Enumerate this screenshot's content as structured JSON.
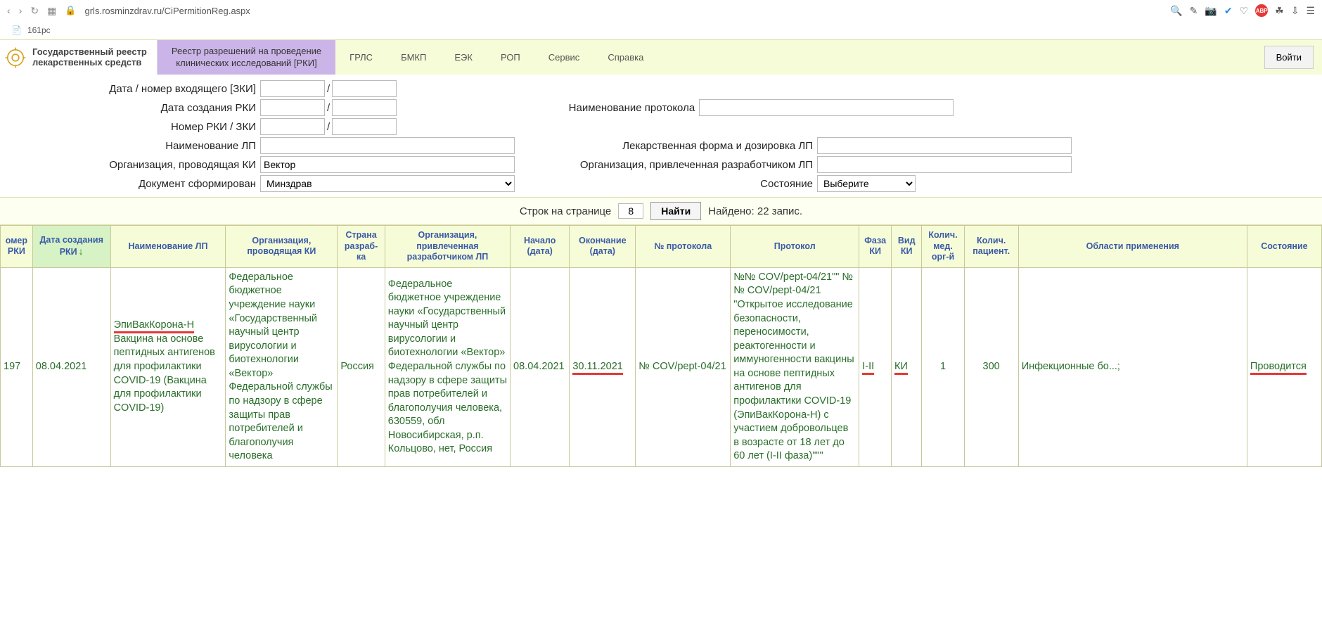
{
  "browser": {
    "url": "grls.rosminzdrav.ru/CiPermitionReg.aspx",
    "tab_title": "161pc"
  },
  "header": {
    "logo_line1": "Государственный реестр",
    "logo_line2": "лекарственных средств",
    "tabs": {
      "active_line1": "Реестр разрешений на проведение",
      "active_line2": "клинических исследований [РКИ]",
      "grls": "ГРЛС",
      "bmkp": "БМКП",
      "eek": "ЕЭК",
      "rop": "РОП",
      "service": "Сервис",
      "help": "Справка"
    },
    "login": "Войти"
  },
  "filters": {
    "l_date_incoming": "Дата / номер входящего [ЗКИ]",
    "l_date_created": "Дата создания РКИ",
    "l_number": "Номер РКИ / ЗКИ",
    "l_lp_name": "Наименование ЛП",
    "l_org_conducting": "Организация, проводящая КИ",
    "l_doc_formed": "Документ сформирован",
    "l_protocol_name": "Наименование протокола",
    "l_dosage_form": "Лекарственная форма и дозировка ЛП",
    "l_org_dev": "Организация, привлеченная разработчиком ЛП",
    "l_state": "Состояние",
    "v_org_conducting": "Вектор",
    "v_doc_formed": "Минздрав",
    "v_state": "Выберите"
  },
  "pager": {
    "rows_label": "Строк на странице",
    "rows_value": "8",
    "find": "Найти",
    "found": "Найдено: 22 запис."
  },
  "columns": {
    "c0": "омер\nРКИ",
    "c1": "Дата создания РКИ",
    "c2": "Наименование ЛП",
    "c3": "Организация, проводящая КИ",
    "c4": "Страна разраб-ка",
    "c5": "Организация, привлеченная разработчиком ЛП",
    "c6": "Начало (дата)",
    "c7": "Окончание (дата)",
    "c8": "№ протокола",
    "c9": "Протокол",
    "c10": "Фаза КИ",
    "c11": "Вид КИ",
    "c12": "Колич. мед. орг-й",
    "c13": "Колич. пациент.",
    "c14": "Области применения",
    "c15": "Состояние"
  },
  "row": {
    "number": "197",
    "date_created": "08.04.2021",
    "lp_name_hl": "ЭпиВакКорона-Н",
    "lp_name_rest": "Вакцина на основе пептидных антигенов для профилактики COVID-19 (Вакцина для профилактики COVID-19)",
    "org_conducting": "Федеральное бюджетное учреждение науки «Государственный научный центр вирусологии и биотехнологии «Вектор» Федеральной службы по надзору в сфере защиты прав потребителей и благополучия человека",
    "country": "Россия",
    "org_dev": "Федеральное бюджетное учреждение науки «Государственный научный центр вирусологии и биотехнологии «Вектор» Федеральной службы по надзору в сфере защиты прав потребителей и благополучия человека, 630559, обл Новосибирская, р.п. Кольцово, нет, Россия",
    "start": "08.04.2021",
    "end": "30.11.2021",
    "protocol_no": "№ COV/pept-04/21",
    "protocol": "№№ COV/pept-04/21\"\" № № COV/pept-04/21 \"Открытое исследование безопасности, переносимости, реактогенности и иммуногенности вакцины на основе пептидных антигенов для профилактики COVID-19 (ЭпиВакКорона-Н) с участием добровольцев в возрасте от 18 лет до 60 лет (I-II фаза)\"\"\"",
    "phase": "I-II",
    "type": "КИ",
    "org_count": "1",
    "patient_count": "300",
    "areas": "Инфекционные бо...;",
    "state": "Проводится"
  }
}
